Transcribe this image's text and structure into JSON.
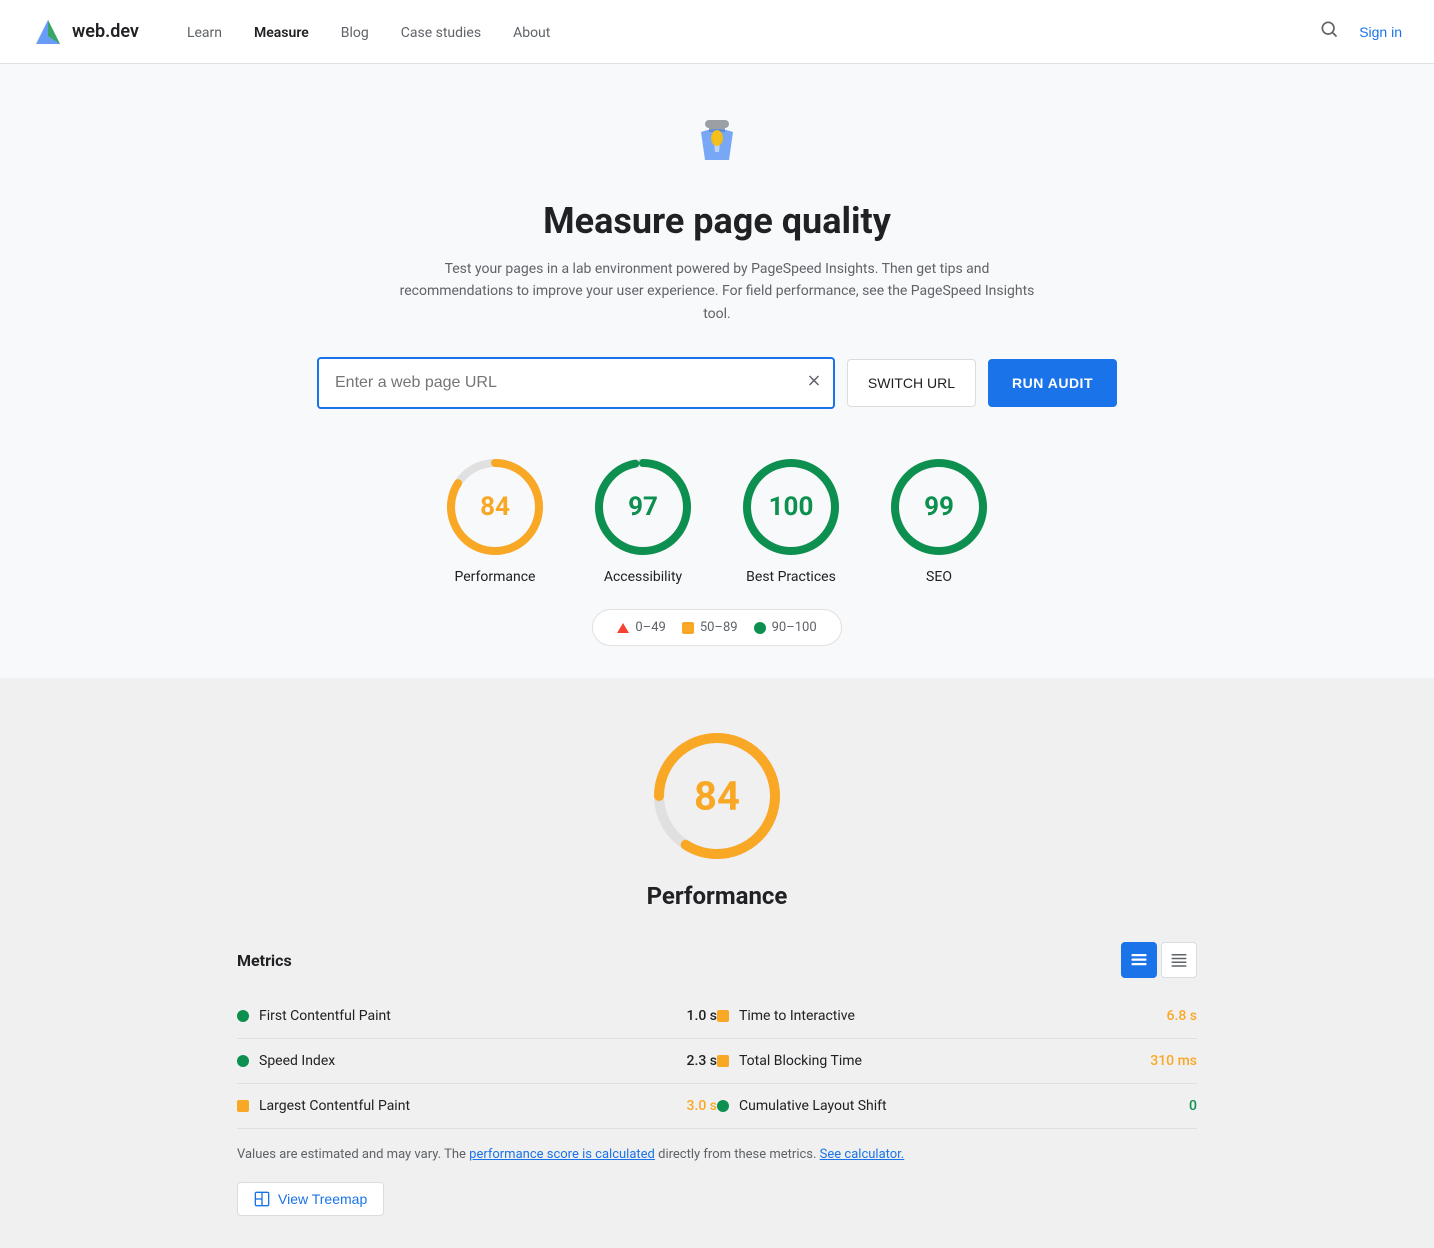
{
  "nav": {
    "logo_text": "web.dev",
    "links": [
      {
        "label": "Learn",
        "active": false
      },
      {
        "label": "Measure",
        "active": true
      },
      {
        "label": "Blog",
        "active": false
      },
      {
        "label": "Case studies",
        "active": false
      },
      {
        "label": "About",
        "active": false
      }
    ],
    "sign_in": "Sign in"
  },
  "hero": {
    "title": "Measure page quality",
    "description": "Test your pages in a lab environment powered by PageSpeed Insights. Then get tips and recommendations to improve your user experience. For field performance, see the PageSpeed Insights tool."
  },
  "url_bar": {
    "placeholder": "Enter a web page URL",
    "switch_url_label": "SWITCH URL",
    "run_audit_label": "RUN AUDIT"
  },
  "scores": [
    {
      "value": 84,
      "label": "Performance",
      "color": "#f9a825",
      "pct": 84
    },
    {
      "value": 97,
      "label": "Accessibility",
      "color": "#0d904f",
      "pct": 97
    },
    {
      "value": 100,
      "label": "Best Practices",
      "color": "#0d904f",
      "pct": 100
    },
    {
      "value": 99,
      "label": "SEO",
      "color": "#0d904f",
      "pct": 99
    }
  ],
  "legend": [
    {
      "range": "0–49",
      "type": "triangle",
      "color": "#f44336"
    },
    {
      "range": "50–89",
      "type": "square",
      "color": "#f9a825"
    },
    {
      "range": "90–100",
      "type": "circle",
      "color": "#0d904f"
    }
  ],
  "performance": {
    "score": 84,
    "title": "Performance",
    "metrics_title": "Metrics",
    "metrics": [
      {
        "name": "First Contentful Paint",
        "value": "1.0 s",
        "dot_color": "#0d904f",
        "dot_type": "circle",
        "value_class": "normal"
      },
      {
        "name": "Time to Interactive",
        "value": "6.8 s",
        "dot_color": "#f9a825",
        "dot_type": "square",
        "value_class": "orange"
      },
      {
        "name": "Speed Index",
        "value": "2.3 s",
        "dot_color": "#0d904f",
        "dot_type": "circle",
        "value_class": "normal"
      },
      {
        "name": "Total Blocking Time",
        "value": "310 ms",
        "dot_color": "#f9a825",
        "dot_type": "square",
        "value_class": "orange"
      },
      {
        "name": "Largest Contentful Paint",
        "value": "3.0 s",
        "dot_color": "#f9a825",
        "dot_type": "square",
        "value_class": "orange"
      },
      {
        "name": "Cumulative Layout Shift",
        "value": "0",
        "dot_color": "#0d904f",
        "dot_type": "circle",
        "value_class": "green"
      }
    ],
    "note_text": "Values are estimated and may vary. The ",
    "note_link1": "performance score is calculated",
    "note_mid": " directly from these metrics. ",
    "note_link2": "See calculator.",
    "treemap_label": "View Treemap"
  }
}
